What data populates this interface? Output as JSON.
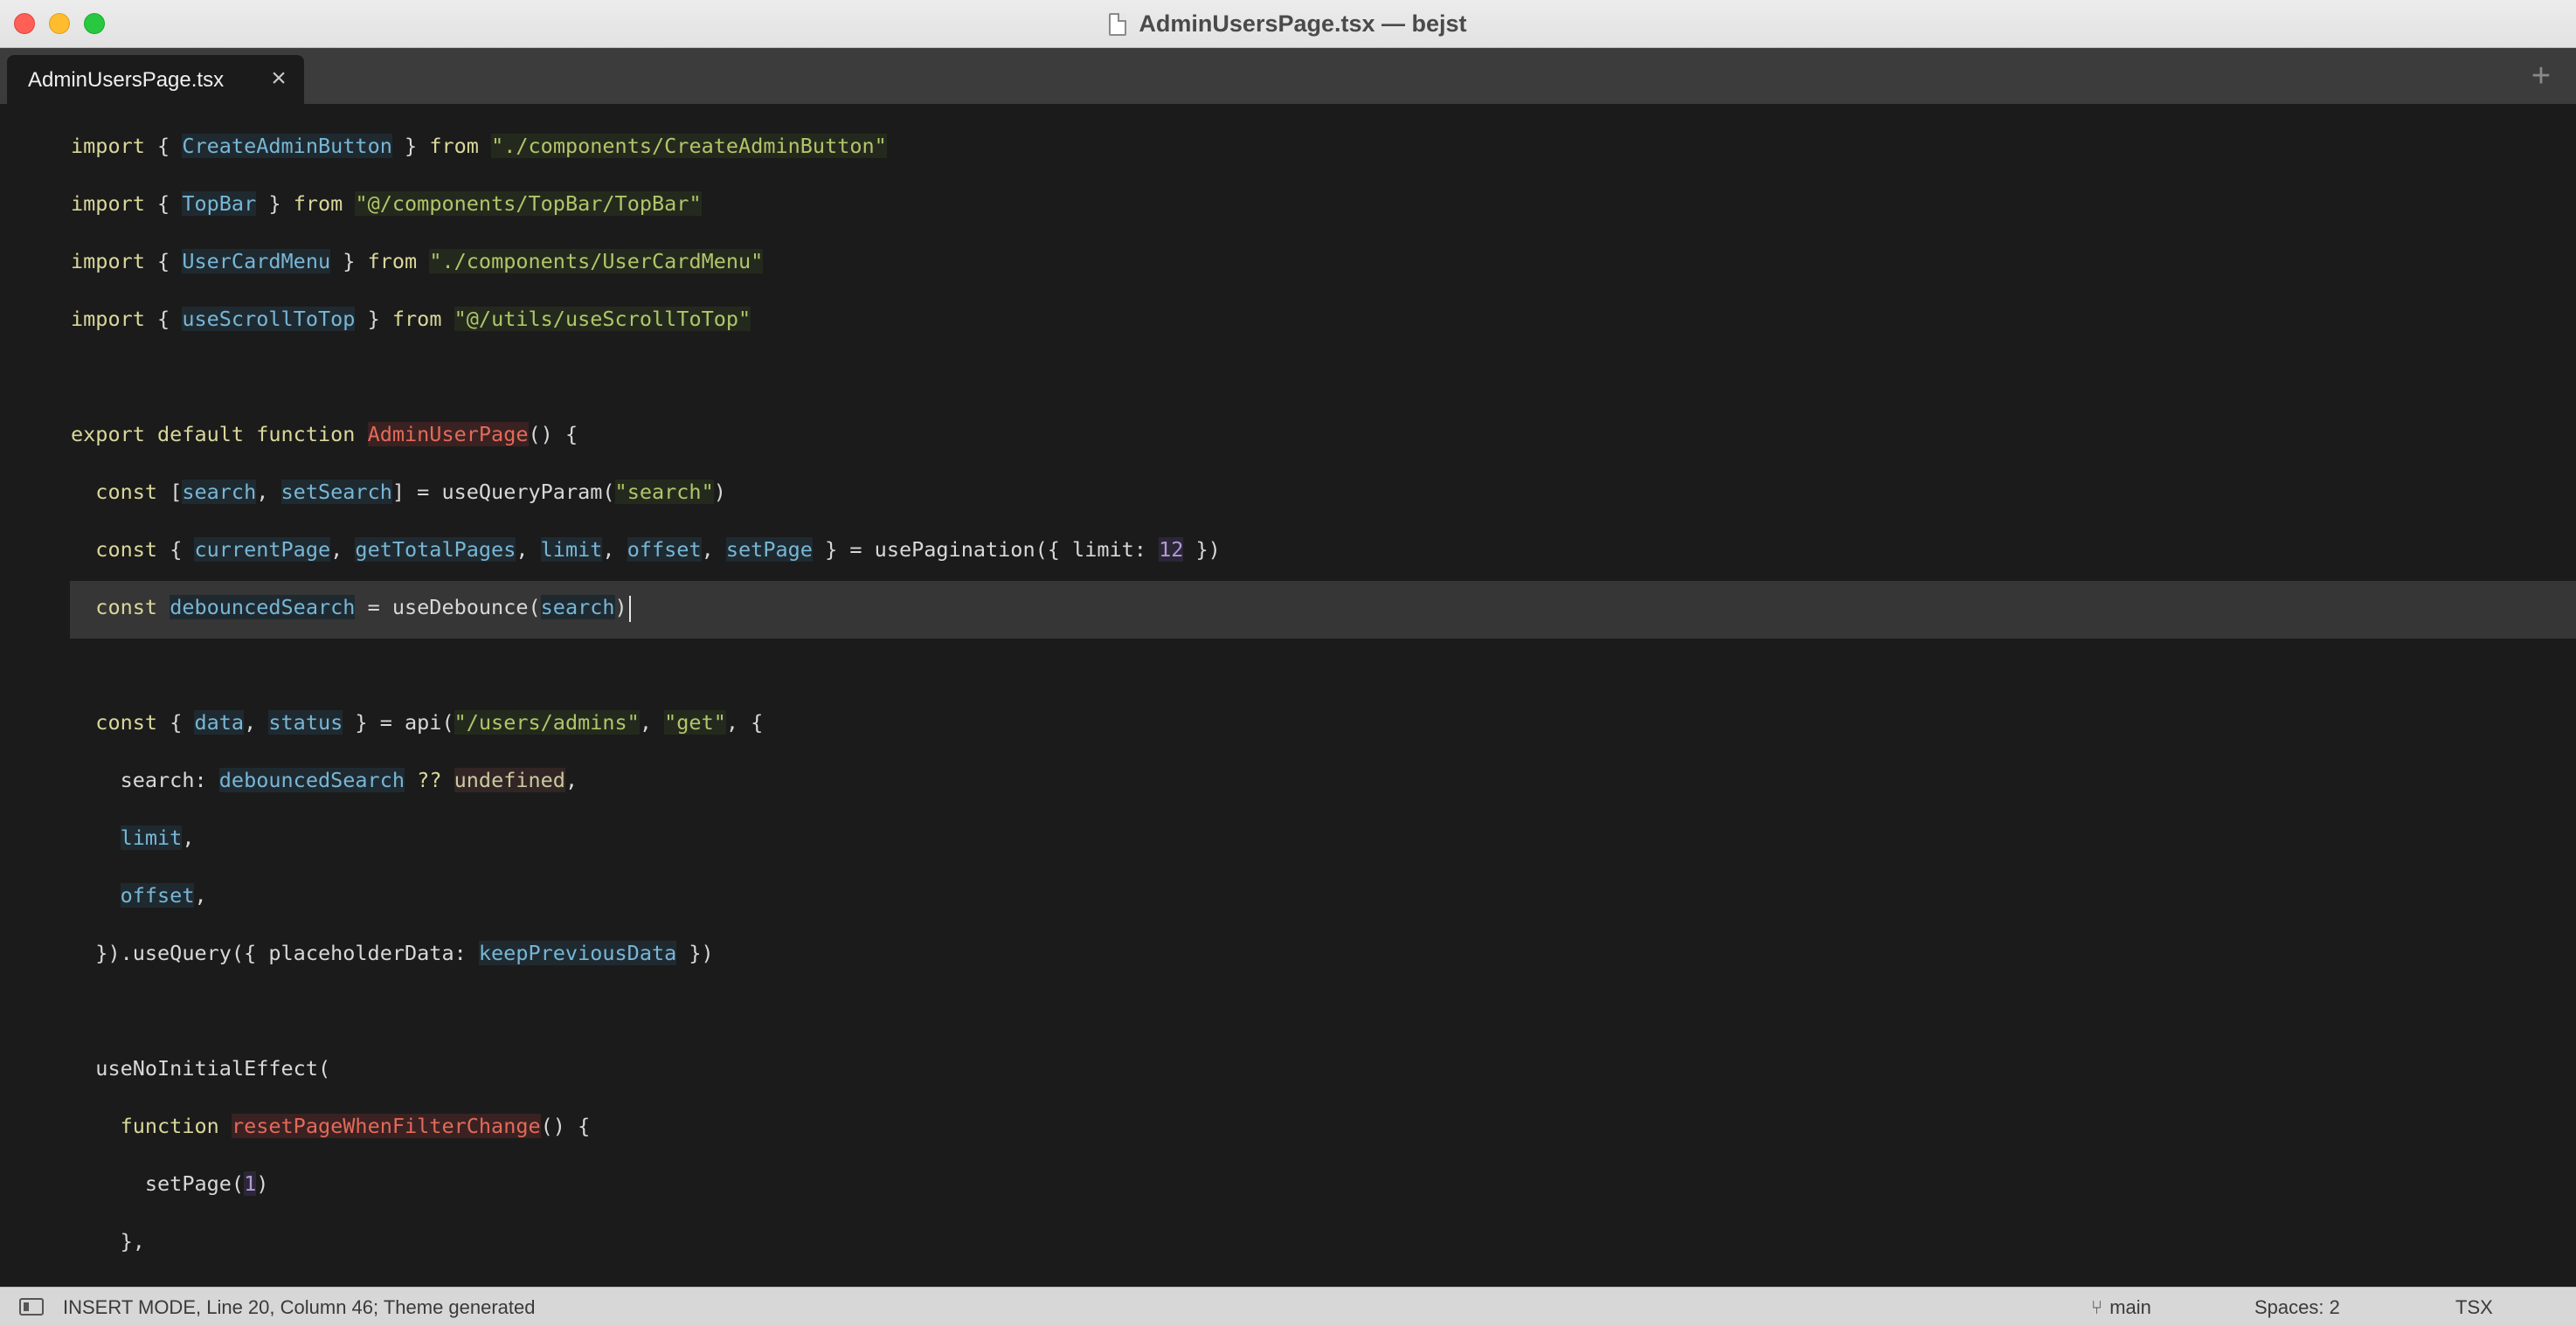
{
  "window": {
    "title": "AdminUsersPage.tsx — bejst"
  },
  "tabs": [
    {
      "label": "AdminUsersPage.tsx",
      "close": "×"
    }
  ],
  "tab_add": "+",
  "editor": {
    "lines": [
      {
        "segs": [
          [
            "kw",
            "import "
          ],
          [
            "plain",
            "{ "
          ],
          [
            "id",
            "CreateAdminButton"
          ],
          [
            "plain",
            " } "
          ],
          [
            "kw",
            "from "
          ],
          [
            "str",
            "\"./components/CreateAdminButton\""
          ]
        ]
      },
      {
        "segs": [
          [
            "kw",
            "import "
          ],
          [
            "plain",
            "{ "
          ],
          [
            "id",
            "TopBar"
          ],
          [
            "plain",
            " } "
          ],
          [
            "kw",
            "from "
          ],
          [
            "str",
            "\"@/components/TopBar/TopBar\""
          ]
        ]
      },
      {
        "segs": [
          [
            "kw",
            "import "
          ],
          [
            "plain",
            "{ "
          ],
          [
            "id",
            "UserCardMenu"
          ],
          [
            "plain",
            " } "
          ],
          [
            "kw",
            "from "
          ],
          [
            "str",
            "\"./components/UserCardMenu\""
          ]
        ]
      },
      {
        "segs": [
          [
            "kw",
            "import "
          ],
          [
            "plain",
            "{ "
          ],
          [
            "id",
            "useScrollToTop"
          ],
          [
            "plain",
            " } "
          ],
          [
            "kw",
            "from "
          ],
          [
            "str",
            "\"@/utils/useScrollToTop\""
          ]
        ]
      },
      {
        "segs": []
      },
      {
        "segs": [
          [
            "kw",
            "export default function "
          ],
          [
            "fn",
            "AdminUserPage"
          ],
          [
            "plain",
            "() {"
          ]
        ]
      },
      {
        "segs": [
          [
            "plain",
            "  "
          ],
          [
            "kw",
            "const "
          ],
          [
            "plain",
            "["
          ],
          [
            "id",
            "search"
          ],
          [
            "plain",
            ", "
          ],
          [
            "id",
            "setSearch"
          ],
          [
            "plain",
            "] = useQueryParam("
          ],
          [
            "str",
            "\"search\""
          ],
          [
            "plain",
            ")"
          ]
        ]
      },
      {
        "segs": [
          [
            "plain",
            "  "
          ],
          [
            "kw",
            "const "
          ],
          [
            "plain",
            "{ "
          ],
          [
            "id",
            "currentPage"
          ],
          [
            "plain",
            ", "
          ],
          [
            "id",
            "getTotalPages"
          ],
          [
            "plain",
            ", "
          ],
          [
            "id",
            "limit"
          ],
          [
            "plain",
            ", "
          ],
          [
            "id",
            "offset"
          ],
          [
            "plain",
            ", "
          ],
          [
            "id",
            "setPage"
          ],
          [
            "plain",
            " } = usePagination({ limit: "
          ],
          [
            "num",
            "12"
          ],
          [
            "plain",
            " })"
          ]
        ]
      },
      {
        "segs": [
          [
            "plain",
            "  "
          ],
          [
            "kw",
            "const "
          ],
          [
            "id",
            "debouncedSearch"
          ],
          [
            "plain",
            " = useDebounce("
          ],
          [
            "id",
            "search"
          ],
          [
            "plain",
            ")"
          ]
        ],
        "cursor": true
      },
      {
        "segs": []
      },
      {
        "segs": [
          [
            "plain",
            "  "
          ],
          [
            "kw",
            "const "
          ],
          [
            "plain",
            "{ "
          ],
          [
            "id",
            "data"
          ],
          [
            "plain",
            ", "
          ],
          [
            "id",
            "status"
          ],
          [
            "plain",
            " } = api("
          ],
          [
            "str",
            "\"/users/admins\""
          ],
          [
            "plain",
            ", "
          ],
          [
            "str",
            "\"get\""
          ],
          [
            "plain",
            ", {"
          ]
        ]
      },
      {
        "segs": [
          [
            "plain",
            "    search: "
          ],
          [
            "id",
            "debouncedSearch"
          ],
          [
            "plain",
            " "
          ],
          [
            "kw",
            "??"
          ],
          [
            "plain",
            " "
          ],
          [
            "und",
            "undefined"
          ],
          [
            "plain",
            ","
          ]
        ]
      },
      {
        "segs": [
          [
            "plain",
            "    "
          ],
          [
            "id",
            "limit"
          ],
          [
            "plain",
            ","
          ]
        ]
      },
      {
        "segs": [
          [
            "plain",
            "    "
          ],
          [
            "id",
            "offset"
          ],
          [
            "plain",
            ","
          ]
        ]
      },
      {
        "segs": [
          [
            "plain",
            "  }).useQuery({ placeholderData: "
          ],
          [
            "id",
            "keepPreviousData"
          ],
          [
            "plain",
            " })"
          ]
        ]
      },
      {
        "segs": []
      },
      {
        "segs": [
          [
            "plain",
            "  useNoInitialEffect("
          ]
        ]
      },
      {
        "segs": [
          [
            "plain",
            "    "
          ],
          [
            "kw",
            "function "
          ],
          [
            "fn",
            "resetPageWhenFilterChange"
          ],
          [
            "plain",
            "() {"
          ]
        ]
      },
      {
        "segs": [
          [
            "plain",
            "      setPage("
          ],
          [
            "num",
            "1"
          ],
          [
            "plain",
            ")"
          ]
        ]
      },
      {
        "segs": [
          [
            "plain",
            "    },"
          ]
        ]
      }
    ]
  },
  "status": {
    "text": "INSERT MODE, Line 20, Column 46; Theme generated",
    "branch": "main",
    "spaces": "Spaces: 2",
    "syntax": "TSX"
  },
  "colors": {
    "traffic_close": "#fe5f57",
    "traffic_min": "#febc2e",
    "traffic_max": "#28c840",
    "editor_bg": "#1b1b1b",
    "current_line": "#363636"
  }
}
